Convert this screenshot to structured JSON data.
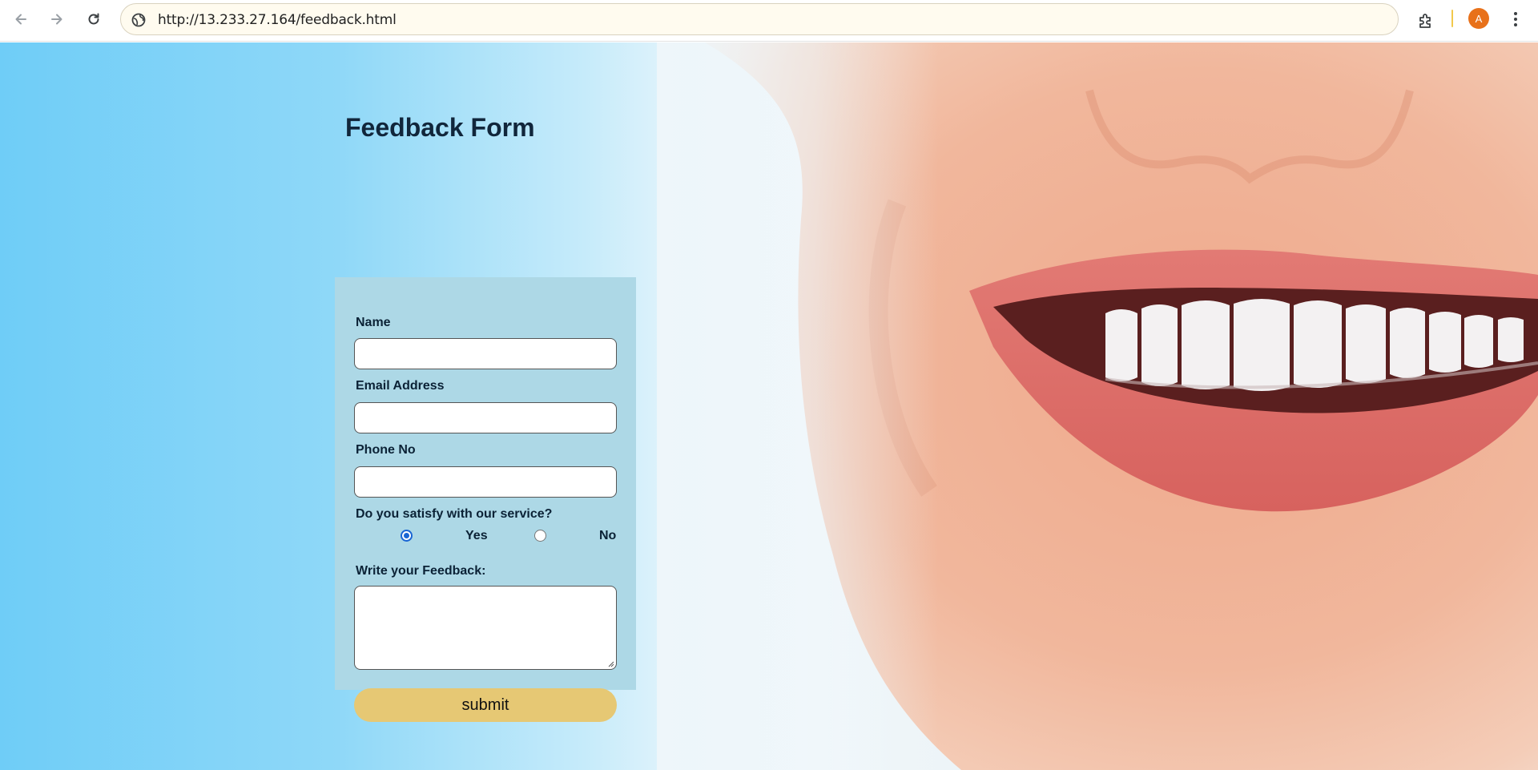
{
  "browser": {
    "url": "http://13.233.27.164/feedback.html",
    "profile_initial": "A"
  },
  "page": {
    "title": "Feedback Form"
  },
  "form": {
    "name_label": "Name",
    "email_label": "Email Address",
    "phone_label": "Phone No",
    "service_question": "Do you satisfy with our service?",
    "options": [
      {
        "label": "Yes",
        "checked": true
      },
      {
        "label": "No",
        "checked": false
      }
    ],
    "feedback_label": "Write your Feedback:",
    "submit_label": "submit"
  },
  "icons": [
    "back-arrow-icon",
    "forward-arrow-icon",
    "reload-icon",
    "site-info-icon",
    "extensions-icon",
    "kebab-menu-icon"
  ],
  "colors": {
    "panel": "#add8e6",
    "submit": "#e6c874",
    "radio_accent": "#1a66d4",
    "title": "#11263b"
  }
}
